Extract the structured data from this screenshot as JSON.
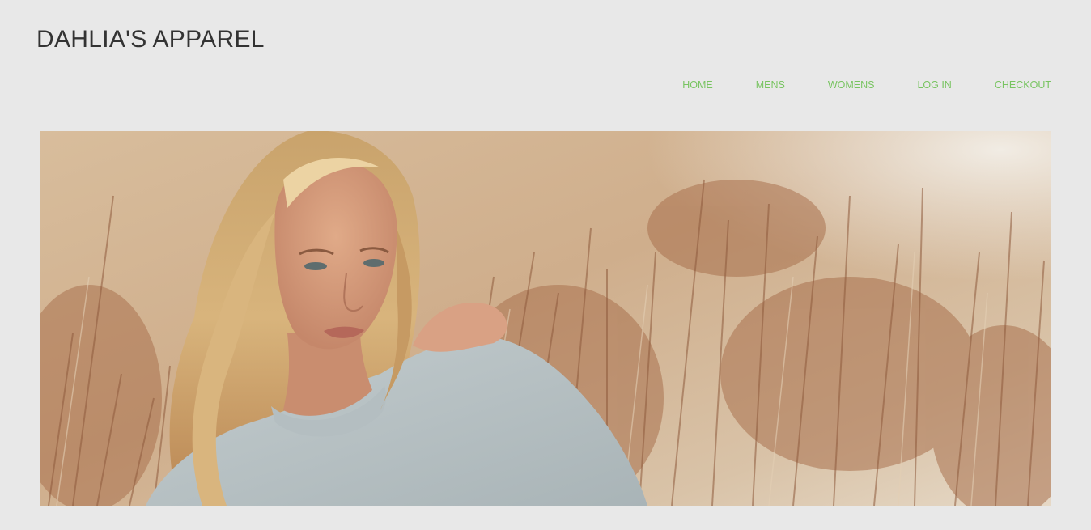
{
  "header": {
    "site_title": "DAHLIA'S APPAREL"
  },
  "nav": {
    "items": [
      {
        "label": "HOME"
      },
      {
        "label": "MENS"
      },
      {
        "label": "WOMENS"
      },
      {
        "label": "LOG IN"
      },
      {
        "label": "CHECKOUT"
      }
    ],
    "link_color": "#78c461"
  },
  "hero": {
    "subject": "woman in grey sweater sitting in dry golden grass"
  },
  "colors": {
    "page_background": "#e8e8e8",
    "title_text": "#333333",
    "nav_link": "#78c461"
  }
}
